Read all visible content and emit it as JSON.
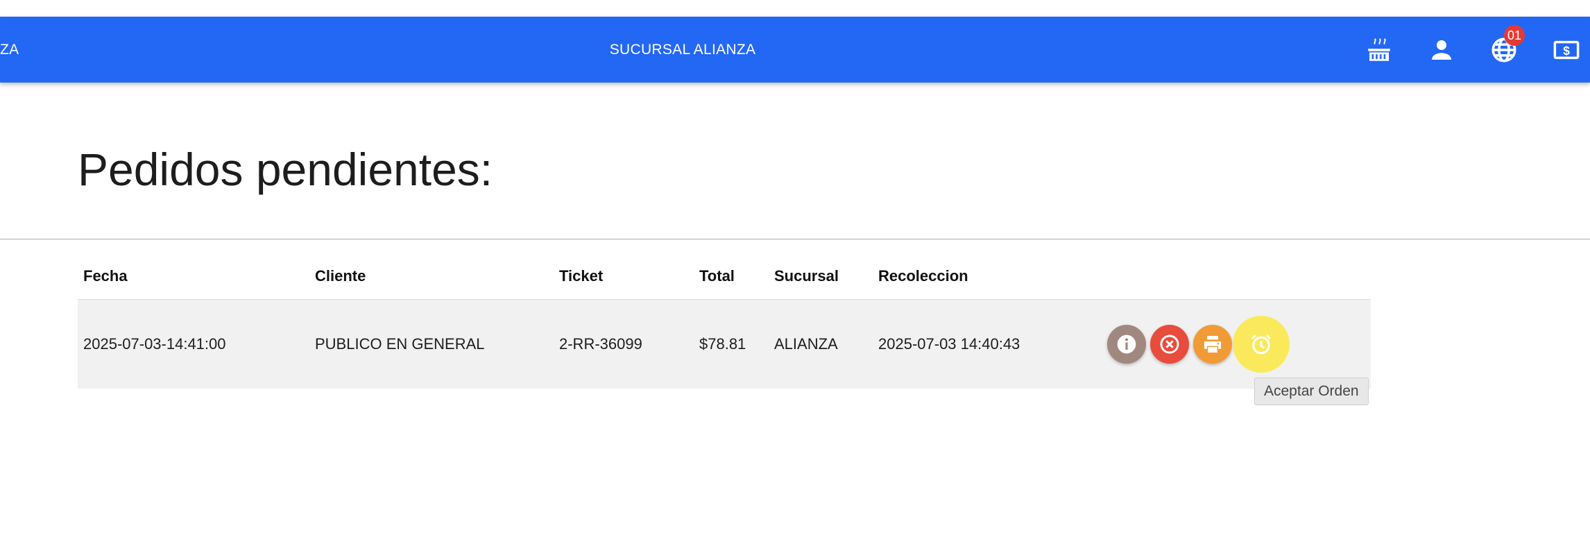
{
  "header": {
    "brand_fragment": "ZA",
    "branch_title": "SUCURSAL ALIANZA",
    "icons": [
      {
        "name": "kitchen-grill-icon"
      },
      {
        "name": "user-icon"
      },
      {
        "name": "globe-orders-icon",
        "badge": "01"
      },
      {
        "name": "cash-register-icon"
      }
    ],
    "accent_color": "#2367f5"
  },
  "main": {
    "title": "Pedidos pendientes:"
  },
  "table": {
    "columns": [
      "Fecha",
      "Cliente",
      "Ticket",
      "Total",
      "Sucursal",
      "Recoleccion"
    ],
    "rows": [
      {
        "fecha": "2025-07-03-14:41:00",
        "cliente": "PUBLICO EN GENERAL",
        "ticket": "2-RR-36099",
        "total": "$78.81",
        "sucursal": "ALIANZA",
        "recoleccion": "2025-07-03 14:40:43"
      }
    ],
    "actions": [
      {
        "name": "info-icon",
        "color": "#a1887f"
      },
      {
        "name": "cancel-icon",
        "color": "#e84c3d"
      },
      {
        "name": "print-icon",
        "color": "#f19b36"
      },
      {
        "name": "alarm-clock-icon",
        "color": "#fbe95c"
      }
    ]
  },
  "tooltip": {
    "text": "Aceptar Orden"
  }
}
